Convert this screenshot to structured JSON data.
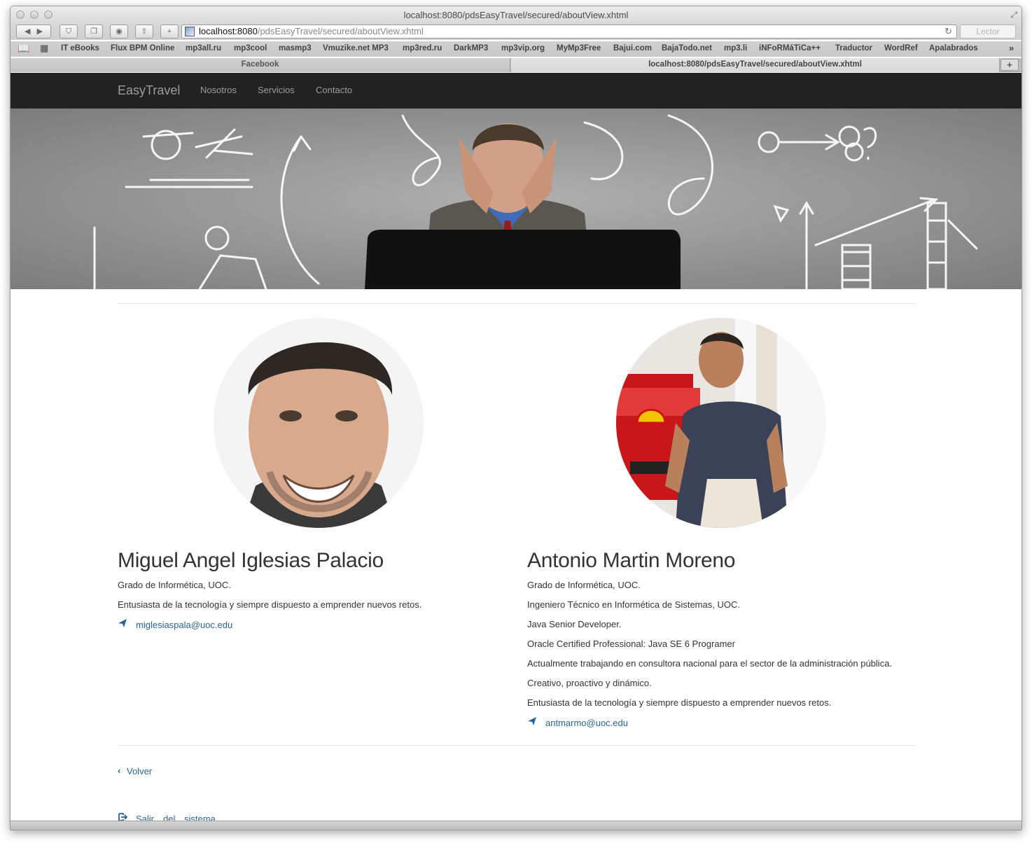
{
  "browser": {
    "window_title": "localhost:8080/pdsEasyTravel/secured/aboutView.xhtml",
    "url_host": "localhost:8080",
    "url_path": "/pdsEasyTravel/secured/aboutView.xhtml",
    "reader_label": "Lector",
    "bookmarks": [
      "IT eBooks",
      "Flux BPM Online",
      "mp3all.ru",
      "mp3cool",
      "masmp3",
      "Vmuzike.net MP3",
      "mp3red.ru",
      "DarkMP3",
      "mp3vip.org",
      "MyMp3Free",
      "Bajui.com",
      "BajaTodo.net",
      "mp3.li",
      "iNFoRMáTiCa++",
      "Traductor",
      "WordRef",
      "Apalabrados"
    ],
    "tabs": [
      {
        "label": "Facebook",
        "active": false
      },
      {
        "label": "localhost:8080/pdsEasyTravel/secured/aboutView.xhtml",
        "active": true
      }
    ]
  },
  "navbar": {
    "brand": "EasyTravel",
    "links": [
      "Nosotros",
      "Servicios",
      "Contacto"
    ],
    "background": "#222222",
    "text_color": "#9d9d9d"
  },
  "people": [
    {
      "name": "Miguel Angel Iglesias Palacio",
      "lines": [
        "Grado de Informética, UOC.",
        "Entusiasta de la tecnología y siempre dispuesto a emprender nuevos retos."
      ],
      "email": "miglesiaspala@uoc.edu"
    },
    {
      "name": "Antonio Martin Moreno",
      "lines": [
        "Grado de Informética, UOC.",
        "Ingeniero Técnico en Informética de Sistemas, UOC.",
        "Java Senior Developer.",
        "Oracle Certified Professional: Java SE 6 Programer",
        "Actualmente trabajando en consultora nacional para el sector de la administración pública.",
        "Creativo, proactivo y dinámico.",
        "Entusiasta de la tecnología y siempre dispuesto a emprender nuevos retos."
      ],
      "email": "antmarmo@uoc.edu"
    }
  ],
  "footer": {
    "back_label": "Volver",
    "logout_words": [
      "Salir",
      "del",
      "sistema"
    ]
  },
  "colors": {
    "link": "#2a6496",
    "text": "#333333"
  },
  "icons": {
    "send": "paper-plane-icon",
    "back": "chevron-left-icon",
    "logout": "log-out-icon"
  }
}
